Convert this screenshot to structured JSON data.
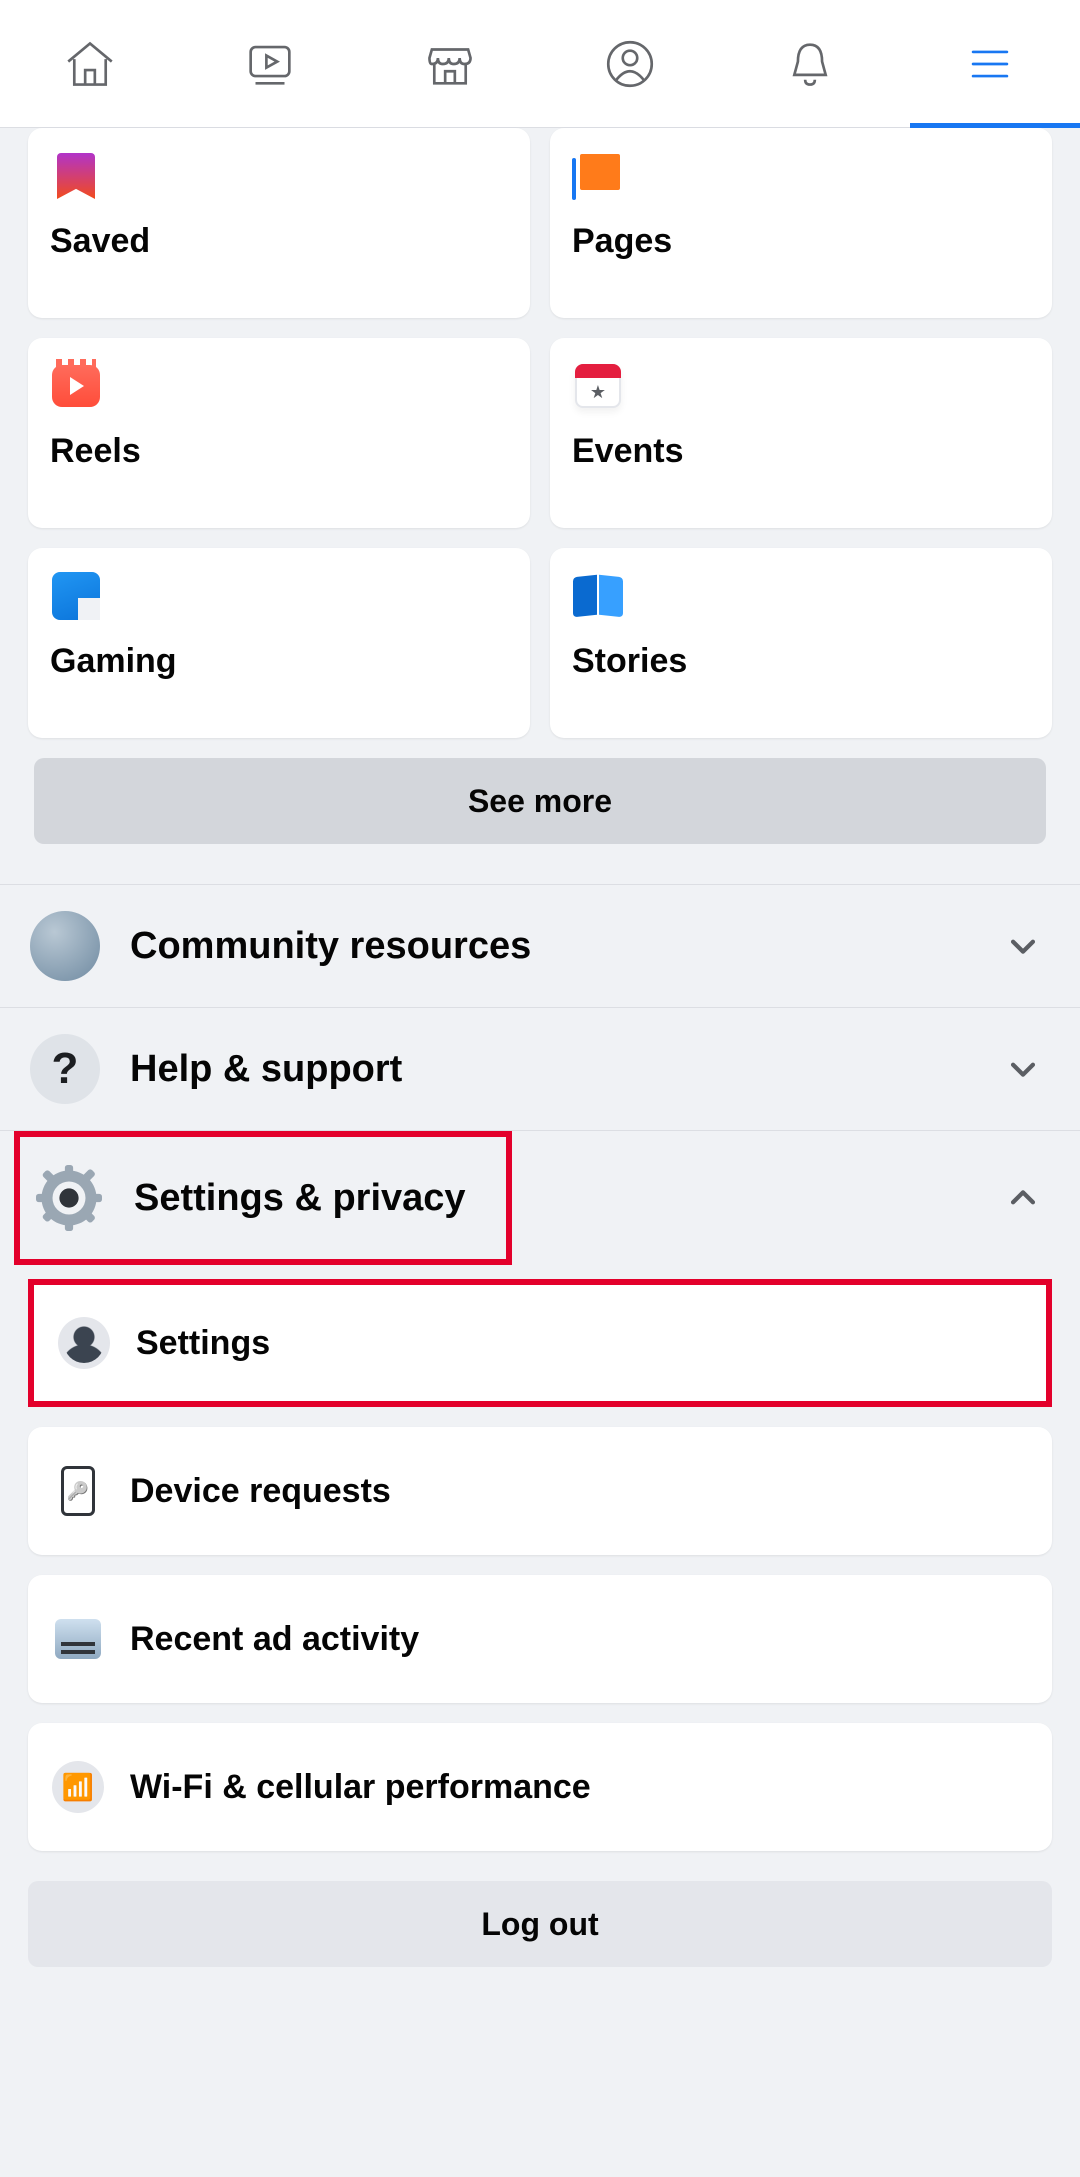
{
  "nav": {
    "tabs": [
      "home",
      "video",
      "marketplace",
      "profile",
      "notifications",
      "menu"
    ],
    "active": "menu"
  },
  "shortcuts": [
    {
      "id": "saved",
      "label": "Saved"
    },
    {
      "id": "pages",
      "label": "Pages"
    },
    {
      "id": "reels",
      "label": "Reels"
    },
    {
      "id": "events",
      "label": "Events"
    },
    {
      "id": "gaming",
      "label": "Gaming"
    },
    {
      "id": "stories",
      "label": "Stories"
    }
  ],
  "see_more_label": "See more",
  "sections": {
    "community": {
      "label": "Community resources",
      "expanded": false
    },
    "help": {
      "label": "Help & support",
      "expanded": false
    },
    "settings": {
      "label": "Settings & privacy",
      "expanded": true
    }
  },
  "settings_items": [
    {
      "id": "settings",
      "label": "Settings"
    },
    {
      "id": "device_requests",
      "label": "Device requests"
    },
    {
      "id": "recent_ads",
      "label": "Recent ad activity"
    },
    {
      "id": "wifi_perf",
      "label": "Wi-Fi & cellular performance"
    }
  ],
  "logout_label": "Log out",
  "highlights": {
    "settings_section_header": true,
    "settings_subitem": true
  }
}
